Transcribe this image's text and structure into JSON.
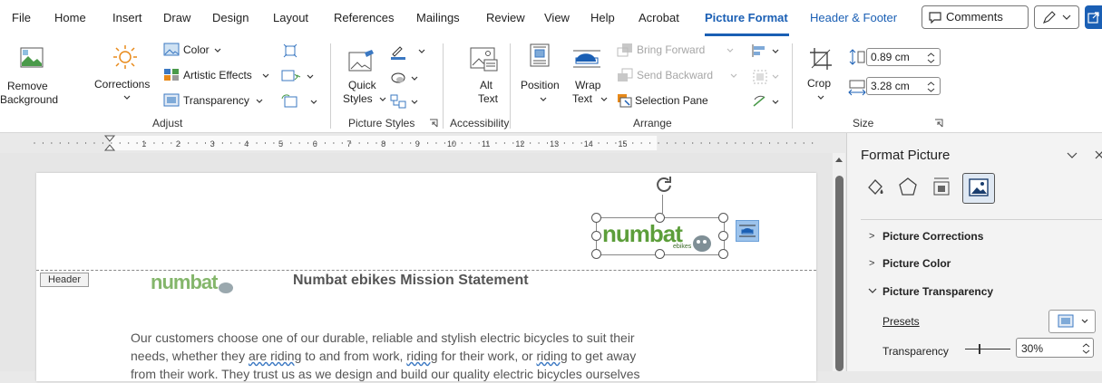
{
  "menu": {
    "items": [
      "File",
      "Home",
      "Insert",
      "Draw",
      "Design",
      "Layout",
      "References",
      "Mailings",
      "Review",
      "View",
      "Help",
      "Acrobat",
      "Picture Format",
      "Header & Footer"
    ],
    "comments_label": "Comments"
  },
  "ribbon": {
    "remove_background": [
      "Remove",
      "Background"
    ],
    "corrections": "Corrections",
    "color": "Color",
    "artistic_effects": "Artistic Effects",
    "transparency": "Transparency",
    "adjust_group": "Adjust",
    "quick_styles": [
      "Quick",
      "Styles"
    ],
    "picture_styles_group": "Picture Styles",
    "alt_text": [
      "Alt",
      "Text"
    ],
    "accessibility_group": "Accessibility",
    "position": "Position",
    "wrap_text": [
      "Wrap",
      "Text"
    ],
    "bring_forward": "Bring Forward",
    "send_backward": "Send Backward",
    "selection_pane": "Selection Pane",
    "arrange_group": "Arrange",
    "crop": "Crop",
    "height_value": "0.89 cm",
    "width_value": "3.28 cm",
    "size_group": "Size"
  },
  "ruler": {
    "numbers": [
      "1",
      "2",
      "3",
      "4",
      "5",
      "6",
      "7",
      "8",
      "9",
      "10",
      "11",
      "12",
      "13",
      "14",
      "15"
    ]
  },
  "document": {
    "header_tag": "Header",
    "logo_text": "numbat",
    "logo_sub": "ebikes",
    "title": "Numbat ebikes Mission Statement",
    "paragraph_line1": "Our customers choose one of our durable, reliable and stylish electric bicycles to suit their",
    "paragraph_line2_parts": [
      "needs, whether they ",
      "are riding",
      " to and from work, ",
      "riding",
      " for their work, or ",
      "riding",
      " to get away"
    ],
    "paragraph_line3": "from their work. They trust us as we design and build our quality electric bicycles ourselves"
  },
  "pane": {
    "title": "Format Picture",
    "sections": [
      "Picture Corrections",
      "Picture Color",
      "Picture Transparency"
    ],
    "presets_label": "Presets",
    "transparency_label": "Transparency",
    "transparency_value": "30%",
    "transparency_fraction": 0.3
  },
  "colors": {
    "accent": "#1a5fb4",
    "logo_green": "#5c9e3a",
    "logo_dark": "#3d6b2a",
    "logo_grey": "#7f8f96"
  }
}
